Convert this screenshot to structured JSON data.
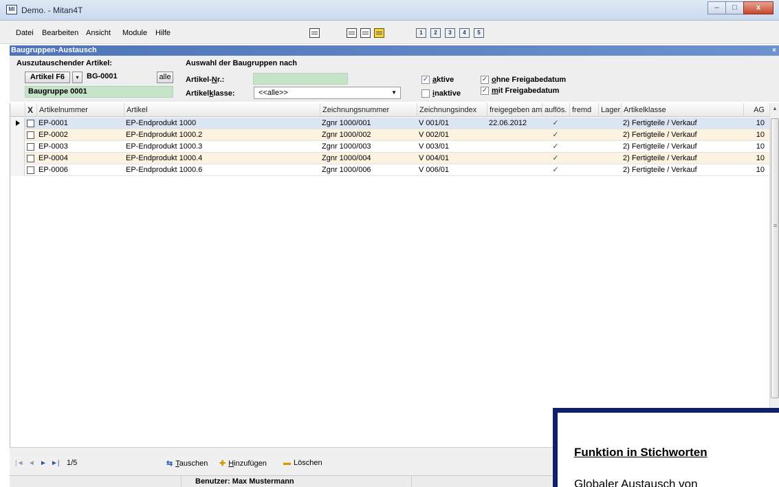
{
  "window": {
    "app_icon": "MI",
    "title": "Demo. - Mitan4T",
    "buttons": [
      "–",
      "□",
      "x"
    ]
  },
  "menu": [
    "Datei",
    "Bearbeiten",
    "Ansicht",
    "Module",
    "Hilfe"
  ],
  "toolbar": {
    "icons": [
      "list-icon",
      "grid-icon",
      "grid-icon",
      "highlight-icon",
      "view-1-icon",
      "view-2-icon",
      "view-3-icon",
      "view-4-icon",
      "view-5-icon"
    ],
    "numbers": [
      "1",
      "2",
      "3",
      "4",
      "5"
    ]
  },
  "section": {
    "title": "Baugruppen-Austausch",
    "close": "×"
  },
  "filter": {
    "replace_label": "Auszutauschender Artikel:",
    "selection_label": "Auswahl der Baugruppen nach",
    "artikel_btn": "Artikel F6",
    "code_value": "BG-0001",
    "alle_btn": "alle",
    "group_name": "Baugruppe 0001",
    "artikel_nr_label_pre": "Artikel-",
    "artikel_nr_label_ul": "N",
    "artikel_nr_label_post": "r.:",
    "artikel_nr_value": "",
    "klasse_label_pre": "Artikel",
    "klasse_label_ul": "k",
    "klasse_label_post": "lasse:",
    "klasse_value": "<<alle>>",
    "aktive_ul": "a",
    "aktive_rest": "ktive",
    "aktive_checked": true,
    "inaktive_ul": "i",
    "inaktive_rest": "naktive",
    "inaktive_checked": false,
    "ohne_ul": "o",
    "ohne_rest": "hne Freigabedatum",
    "ohne_checked": true,
    "mit_ul": "m",
    "mit_rest": "it Freigabedatum",
    "mit_checked": true
  },
  "grid": {
    "columns": [
      "X",
      "Artikelnummer",
      "Artikel",
      "Zeichnungsnummer",
      "Zeichnungsindex",
      "freigegeben am",
      "auflös.",
      "fremd",
      "Lager",
      "Artikelklasse",
      "AG"
    ],
    "rows": [
      [
        "EP-0001",
        "EP-Endprodukt 1000",
        "Zgnr 1000/001",
        "V 001/01",
        "22.06.2012",
        "✓",
        "",
        "",
        "2) Fertigteile / Verkauf",
        "10"
      ],
      [
        "EP-0002",
        "EP-Endprodukt 1000.2",
        "Zgnr 1000/002",
        "V 002/01",
        "",
        "✓",
        "",
        "",
        "2) Fertigteile / Verkauf",
        "10"
      ],
      [
        "EP-0003",
        "EP-Endprodukt 1000.3",
        "Zgnr 1000/003",
        "V 003/01",
        "",
        "✓",
        "",
        "",
        "2) Fertigteile / Verkauf",
        "10"
      ],
      [
        "EP-0004",
        "EP-Endprodukt 1000.4",
        "Zgnr 1000/004",
        "V 004/01",
        "",
        "✓",
        "",
        "",
        "2) Fertigteile / Verkauf",
        "10"
      ],
      [
        "EP-0006",
        "EP-Endprodukt 1000.6",
        "Zgnr 1000/006",
        "V 006/01",
        "",
        "✓",
        "",
        "",
        "2) Fertigteile / Verkauf",
        "10"
      ]
    ],
    "selected_row": 0
  },
  "navigator": {
    "first": "|◄",
    "prev": "◄",
    "next": "►",
    "last": "►|",
    "count": "1/5",
    "tauschen_ul": "T",
    "tauschen_rest": "auschen",
    "hinzufuegen_ul": "H",
    "hinzufuegen_rest": "inzufügen",
    "loeschen": "Löschen"
  },
  "status": {
    "user": "Benutzer: Max Mustermann"
  },
  "callout": {
    "title": "Funktion in Stichworten",
    "text": "Globaler Austausch von"
  },
  "colors": {
    "section_header": "#4d74b8",
    "green_field": "#c5e4c8",
    "selected_row": "#dce6f3",
    "alt_row": "#fbf2df",
    "callout_border": "#12206b"
  }
}
